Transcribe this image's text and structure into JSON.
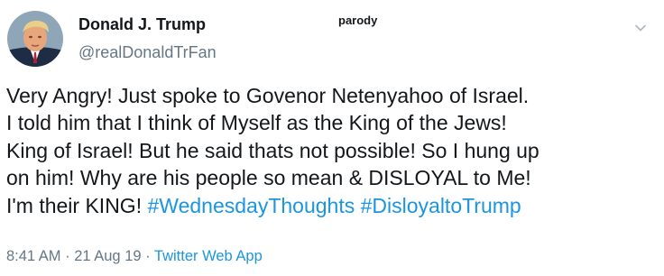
{
  "tweet": {
    "author": {
      "display_name": "Donald J. Trump",
      "handle": "@realDonaldTrFan",
      "label": "parody"
    },
    "text_lines": [
      "Very Angry! Just spoke to Govenor Netenyahoo of Israel.",
      "I told him that I think of Myself as the King of the Jews!",
      "King of Israel! But he said thats not possible! So I hung up",
      "on him! Why are his people so mean & DISLOYAL to Me!"
    ],
    "last_line_text": "I'm their KING! ",
    "hashtags": [
      "#WednesdayThoughts",
      "#DisloyaltoTrump"
    ],
    "time": "8:41 AM",
    "separator": " · ",
    "date": "21 Aug 19",
    "source": "Twitter Web App"
  },
  "icons": {
    "menu": "chevron-down-icon"
  },
  "colors": {
    "text": "#14171a",
    "secondary": "#657786",
    "link": "#1b95e0",
    "background": "#ffffff"
  }
}
